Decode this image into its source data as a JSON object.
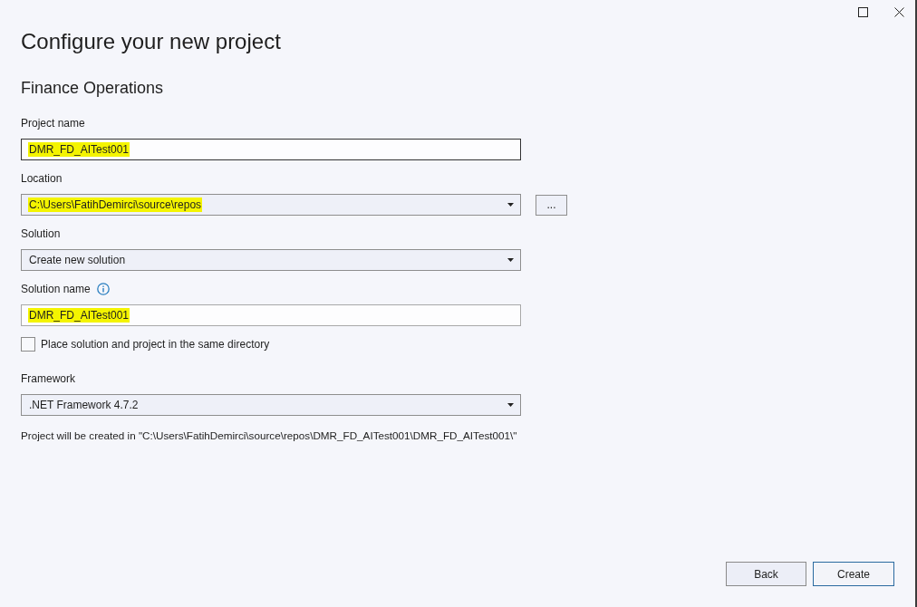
{
  "heading": "Configure your new project",
  "subheading": "Finance Operations",
  "fields": [
    {
      "kind": "text",
      "label": "Project name",
      "value": "DMR_FD_AITest001",
      "highlighted": true,
      "focused": true
    },
    {
      "kind": "dropdown",
      "label": "Location",
      "value": "C:\\Users\\FatihDemirci\\source\\repos",
      "highlighted": true,
      "browse_button": "..."
    },
    {
      "kind": "dropdown",
      "label": "Solution",
      "value": "Create new solution",
      "highlighted": false
    },
    {
      "kind": "text",
      "label": "Solution name",
      "value": "DMR_FD_AITest001",
      "highlighted": true,
      "focused": false,
      "info": true
    },
    {
      "kind": "checkbox",
      "label": "Place solution and project in the same directory",
      "checked": false
    },
    {
      "kind": "dropdown",
      "label": "Framework",
      "value": ".NET Framework 4.7.2",
      "highlighted": false
    }
  ],
  "path_note": "Project will be created in \"C:\\Users\\FatihDemirci\\source\\repos\\DMR_FD_AITest001\\DMR_FD_AITest001\\\"",
  "buttons": [
    {
      "label": "Back",
      "primary": false
    },
    {
      "label": "Create",
      "primary": true
    }
  ]
}
